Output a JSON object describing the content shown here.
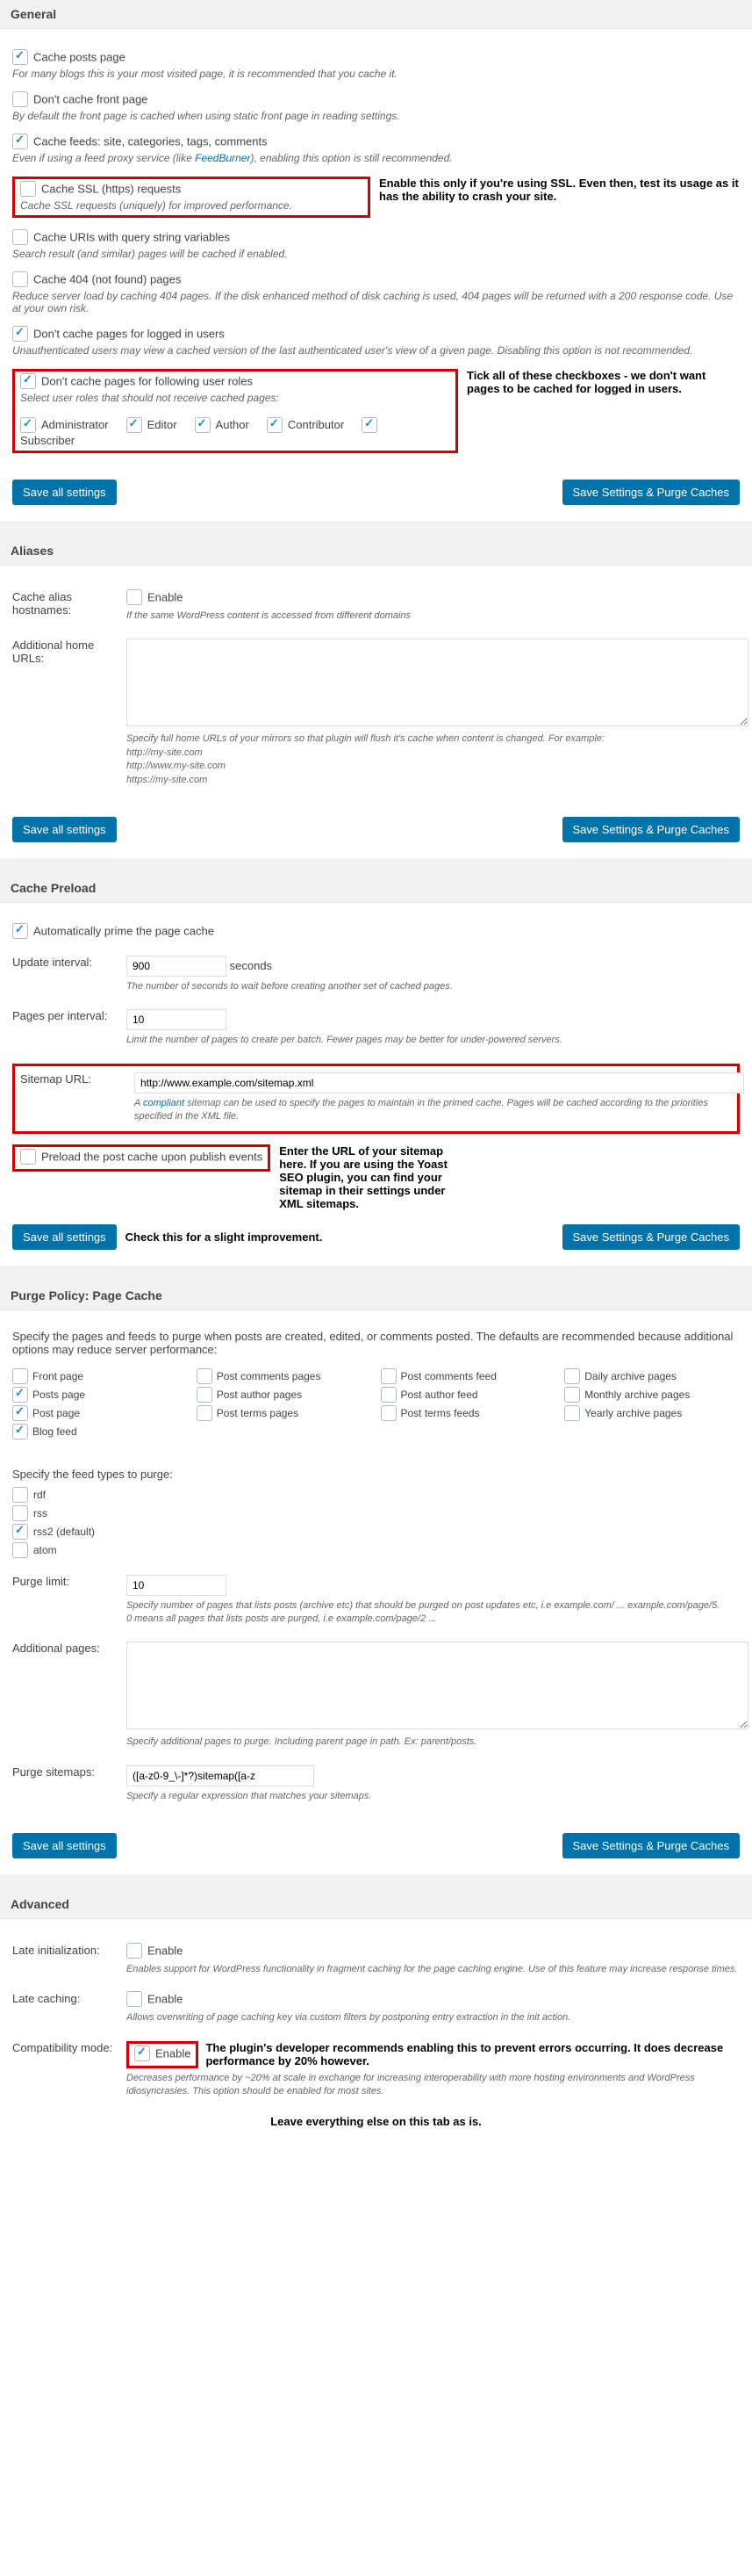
{
  "general": {
    "header": "General",
    "cache_posts": {
      "label": "Cache posts page",
      "desc": "For many blogs this is your most visited page, it is recommended that you cache it.",
      "checked": true
    },
    "dont_cache_front": {
      "label": "Don't cache front page",
      "desc": "By default the front page is cached when using static front page in reading settings.",
      "checked": false
    },
    "cache_feeds": {
      "label": "Cache feeds: site, categories, tags, comments",
      "desc": "Even if using a feed proxy service (like ",
      "link": "FeedBurner",
      "desc2": "), enabling this option is still recommended.",
      "checked": true
    },
    "cache_ssl": {
      "label": "Cache SSL (https) requests",
      "desc": "Cache SSL requests (uniquely) for improved performance.",
      "checked": false
    },
    "ssl_annot": "Enable this only if you're using SSL. Even then, test its usage as it has the ability to crash your site.",
    "cache_query": {
      "label": "Cache URIs with query string variables",
      "desc": "Search result (and similar) pages will be cached if enabled.",
      "checked": false
    },
    "cache_404": {
      "label": "Cache 404 (not found) pages",
      "desc": "Reduce server load by caching 404 pages. If the disk enhanced method of disk caching is used, 404 pages will be returned with a 200 response code. Use at your own risk.",
      "checked": false
    },
    "dont_cache_logged": {
      "label": "Don't cache pages for logged in users",
      "desc": "Unauthenticated users may view a cached version of the last authenticated user's view of a given page. Disabling this option is not recommended.",
      "checked": true
    },
    "dont_cache_roles": {
      "label": "Don't cache pages for following user roles",
      "desc": "Select user roles that should not receive cached pages:",
      "checked": true
    },
    "roles_annot": "Tick all of these checkboxes - we don't want pages to be cached for logged in users.",
    "roles": [
      {
        "l": "Administrator",
        "c": true
      },
      {
        "l": "Editor",
        "c": true
      },
      {
        "l": "Author",
        "c": true
      },
      {
        "l": "Contributor",
        "c": true
      },
      {
        "l": "Subscriber",
        "c": true
      }
    ]
  },
  "btn": {
    "save": "Save all settings",
    "purge": "Save Settings & Purge Caches"
  },
  "aliases": {
    "header": "Aliases",
    "cache_alias": {
      "label": "Cache alias hostnames:",
      "enable": "Enable",
      "desc": "If the same WordPress content is accessed from different domains",
      "checked": false
    },
    "home_urls": {
      "label": "Additional home URLs:",
      "desc": "Specify full home URLs of your mirrors so that plugin will flush it's cache when content is changed. For example:\nhttp://my-site.com\nhttp://www.my-site.com\nhttps://my-site.com"
    }
  },
  "preload": {
    "header": "Cache Preload",
    "auto_prime": {
      "label": "Automatically prime the page cache",
      "checked": true
    },
    "interval": {
      "label": "Update interval:",
      "value": "900",
      "unit": "seconds",
      "desc": "The number of seconds to wait before creating another set of cached pages."
    },
    "pages_per": {
      "label": "Pages per interval:",
      "value": "10",
      "desc": "Limit the number of pages to create per batch. Fewer pages may be better for under-powered servers."
    },
    "sitemap": {
      "label": "Sitemap URL:",
      "value": "http://www.example.com/sitemap.xml",
      "desc_pre": "A ",
      "link": "compliant",
      "desc_post": " sitemap can be used to specify the pages to maintain in the primed cache. Pages will be cached according to the priorities specified in the XML file."
    },
    "sitemap_annot": "Enter the URL of your sitemap here. If you are using the Yoast SEO plugin, you can find your sitemap in their settings under XML sitemaps.",
    "preload_post": {
      "label": "Preload the post cache upon publish events",
      "checked": false
    },
    "preload_annot": "Check this for a slight improvement."
  },
  "purge": {
    "header": "Purge Policy: Page Cache",
    "intro": "Specify the pages and feeds to purge when posts are created, edited, or comments posted. The defaults are recommended because additional options may reduce server performance:",
    "cols": [
      [
        {
          "l": "Front page",
          "c": false
        },
        {
          "l": "Posts page",
          "c": true
        },
        {
          "l": "Post page",
          "c": true
        },
        {
          "l": "Blog feed",
          "c": true
        }
      ],
      [
        {
          "l": "Post comments pages",
          "c": false
        },
        {
          "l": "Post author pages",
          "c": false
        },
        {
          "l": "Post terms pages",
          "c": false
        }
      ],
      [
        {
          "l": "Post comments feed",
          "c": false
        },
        {
          "l": "Post author feed",
          "c": false
        },
        {
          "l": "Post terms feeds",
          "c": false
        }
      ],
      [
        {
          "l": "Daily archive pages",
          "c": false
        },
        {
          "l": "Monthly archive pages",
          "c": false
        },
        {
          "l": "Yearly archive pages",
          "c": false
        }
      ]
    ],
    "feed_intro": "Specify the feed types to purge:",
    "feeds": [
      {
        "l": "rdf",
        "c": false
      },
      {
        "l": "rss",
        "c": false
      },
      {
        "l": "rss2 (default)",
        "c": true
      },
      {
        "l": "atom",
        "c": false
      }
    ],
    "limit": {
      "label": "Purge limit:",
      "value": "10",
      "desc": "Specify number of pages that lists posts (archive etc) that should be purged on post updates etc, i.e example.com/ ... example.com/page/5.\n0 means all pages that lists posts are purged, i.e example.com/page/2 ..."
    },
    "additional": {
      "label": "Additional pages:",
      "desc": "Specify additional pages to purge. Including parent page in path. Ex: parent/posts."
    },
    "sitemaps": {
      "label": "Purge sitemaps:",
      "value": "([a-z0-9_\\-]*?)sitemap([a-z",
      "desc": "Specify a regular expression that matches your sitemaps."
    }
  },
  "advanced": {
    "header": "Advanced",
    "late_init": {
      "label": "Late initialization:",
      "enable": "Enable",
      "checked": false,
      "desc": "Enables support for WordPress functionality in fragment caching for the page caching engine. Use of this feature may increase response times."
    },
    "late_cache": {
      "label": "Late caching:",
      "enable": "Enable",
      "checked": false,
      "desc": "Allows overwriting of page caching key via custom filters by postponing entry extraction in the init action."
    },
    "compat": {
      "label": "Compatibility mode:",
      "enable": "Enable",
      "checked": true,
      "desc": "Decreases performance by ~20% at scale in exchange for increasing interoperability with more hosting environments and WordPress idiosyncrasies. This option should be enabled for most sites."
    },
    "compat_annot": "The plugin's developer recommends enabling this to prevent errors occurring. It does decrease performance by 20% however.",
    "footer_annot": "Leave everything else on this tab as is."
  }
}
